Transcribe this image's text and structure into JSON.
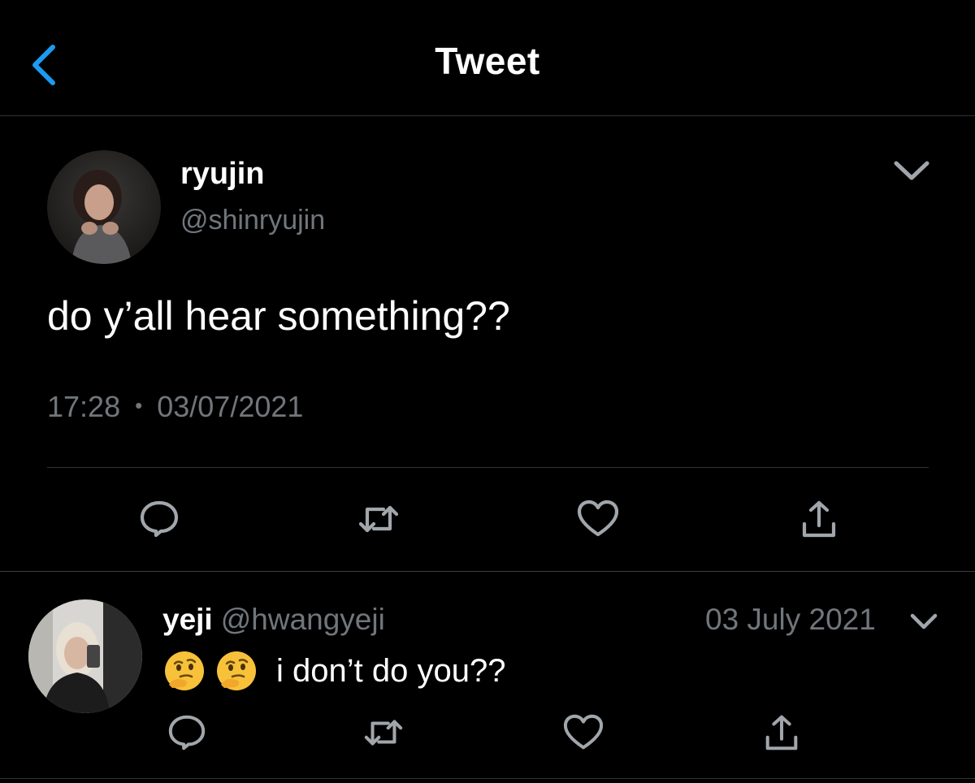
{
  "header": {
    "title": "Tweet",
    "back_icon": "chevron-left-icon",
    "accent_color": "#1d9bf0"
  },
  "tweet": {
    "author_name": "ryujin",
    "author_handle": "@shinryujin",
    "text": "do y’all hear something??",
    "time": "17:28",
    "separator": "•",
    "date": "03/07/2021",
    "menu_icon": "chevron-down-icon",
    "actions": [
      {
        "name": "reply",
        "icon": "comment-icon"
      },
      {
        "name": "retweet",
        "icon": "retweet-icon"
      },
      {
        "name": "like",
        "icon": "heart-icon"
      },
      {
        "name": "share",
        "icon": "share-icon"
      }
    ]
  },
  "reply": {
    "author_name": "yeji",
    "author_handle": "@hwangyeji",
    "date": "03 July 2021",
    "emojis": [
      "🤔",
      "🤔"
    ],
    "text": "i don’t do you??",
    "menu_icon": "chevron-down-icon",
    "actions": [
      {
        "name": "reply",
        "icon": "comment-icon"
      },
      {
        "name": "retweet",
        "icon": "retweet-icon"
      },
      {
        "name": "like",
        "icon": "heart-icon"
      },
      {
        "name": "share",
        "icon": "share-icon"
      }
    ]
  },
  "colors": {
    "background": "#000000",
    "text_primary": "#ffffff",
    "text_secondary": "#71767b",
    "icon": "#a0a6ab",
    "divider": "#2f3336"
  }
}
